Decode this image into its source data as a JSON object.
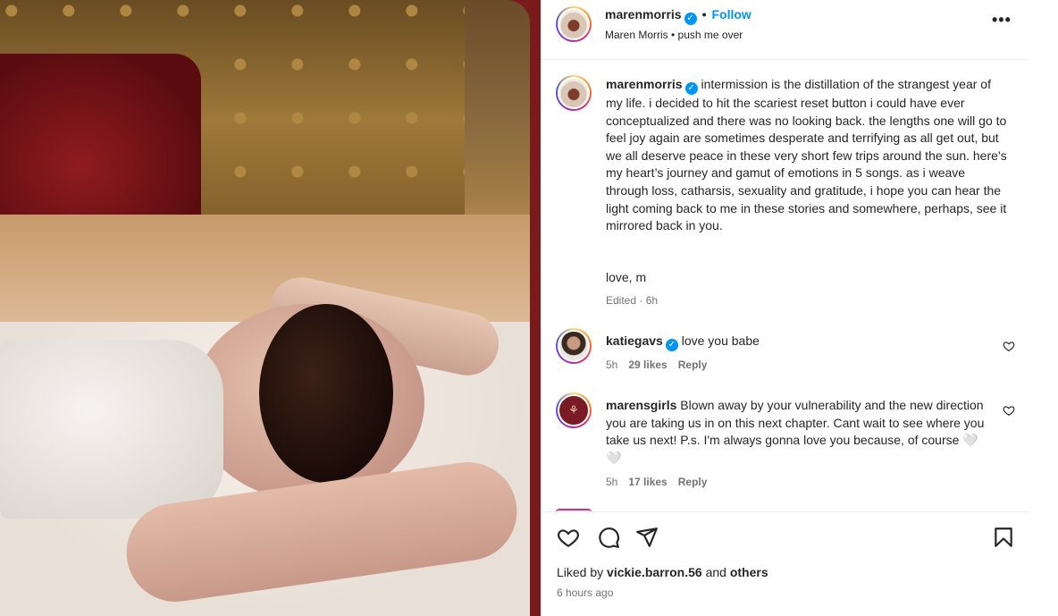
{
  "post": {
    "author": "marenmorris",
    "follow_label": "Follow",
    "separator": "•",
    "subtitle": "Maren Morris • push me over",
    "more_label": "•••"
  },
  "caption": {
    "username": "marenmorris",
    "text": "intermission is the distillation of the strangest year of my life. i decided to hit the scariest reset button i could have ever conceptualized and there was no looking back. the lengths one will go to feel joy again are sometimes desperate and terrifying as all get out, but we all deserve peace in these very short few trips around the sun. here’s my heart’s journey and gamut of emotions in 5 songs. as i weave through loss, catharsis, sexuality and gratitude, i hope you can hear the light coming back to me in these stories and somewhere, perhaps, see it mirrored back in you.",
    "signoff": "love, m",
    "edited": "Edited · 6h"
  },
  "comments": [
    {
      "username": "katiegavs",
      "text": "love you babe",
      "time": "5h",
      "likes": "29 likes",
      "reply": "Reply"
    },
    {
      "username": "marensgirls",
      "text": "Blown away by your vulnerability and the new direction you are taking us in on this next chapter. Cant wait to see where you take us next! P.s. I'm always gonna love you because, of course 🤍🤍",
      "time": "5h",
      "likes": "17 likes",
      "reply": "Reply"
    }
  ],
  "footer": {
    "liked_by_prefix": "Liked by",
    "liked_by_user": "vickie.barron.56",
    "liked_by_and": "and",
    "liked_by_others": "others",
    "time_ago": "6 hours ago"
  },
  "colors": {
    "accent": "#0095f6",
    "text": "#262626",
    "muted": "#737373",
    "photo_frame": "#7a1a1c"
  },
  "icons": {
    "verified": "verified-badge-icon",
    "like": "heart-icon",
    "comment": "comment-icon",
    "share": "paper-plane-icon",
    "save": "bookmark-icon",
    "more": "more-options-icon"
  }
}
